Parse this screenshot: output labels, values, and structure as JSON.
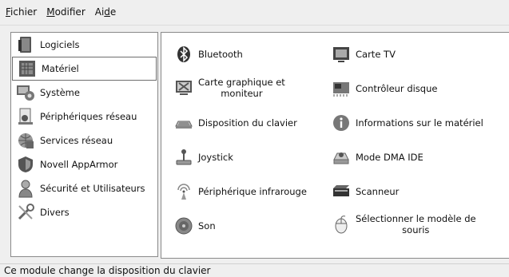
{
  "menubar": {
    "items": [
      {
        "prefix": "",
        "mnemonic": "F",
        "rest": "ichier"
      },
      {
        "prefix": "",
        "mnemonic": "M",
        "rest": "odifier"
      },
      {
        "prefix": "Ai",
        "mnemonic": "d",
        "rest": "e"
      }
    ]
  },
  "sidebar": {
    "items": [
      {
        "label": "Logiciels",
        "icon": "software-icon"
      },
      {
        "label": "Matériel",
        "icon": "hardware-icon"
      },
      {
        "label": "Système",
        "icon": "system-icon"
      },
      {
        "label": "Périphériques réseau",
        "icon": "network-devices-icon"
      },
      {
        "label": "Services réseau",
        "icon": "network-services-icon"
      },
      {
        "label": "Novell AppArmor",
        "icon": "apparmor-icon"
      },
      {
        "label": "Sécurité et Utilisateurs",
        "icon": "security-users-icon"
      },
      {
        "label": "Divers",
        "icon": "misc-tools-icon"
      }
    ],
    "selected_index": 1
  },
  "modules": [
    {
      "label": "Bluetooth",
      "icon": "bluetooth-icon"
    },
    {
      "label": "Carte TV",
      "icon": "tv-card-icon"
    },
    {
      "label": "Carte graphique et moniteur",
      "line1": "Carte graphique et",
      "line2": "moniteur",
      "icon": "graphics-monitor-icon"
    },
    {
      "label": "Contrôleur disque",
      "icon": "disk-controller-icon"
    },
    {
      "label": "Disposition du clavier",
      "icon": "keyboard-icon"
    },
    {
      "label": "Informations sur le matériel",
      "icon": "info-icon"
    },
    {
      "label": "Joystick",
      "icon": "joystick-icon"
    },
    {
      "label": "Mode DMA IDE",
      "icon": "dma-ide-icon"
    },
    {
      "label": "Périphérique infrarouge",
      "icon": "infrared-icon"
    },
    {
      "label": "Scanneur",
      "icon": "scanner-icon"
    },
    {
      "label": "Son",
      "icon": "sound-icon"
    },
    {
      "label": "Sélectionner le modèle de souris",
      "line1": "Sélectionner le modèle de",
      "line2": "souris",
      "icon": "mouse-icon"
    }
  ],
  "status_text": "Ce module change la disposition du clavier"
}
